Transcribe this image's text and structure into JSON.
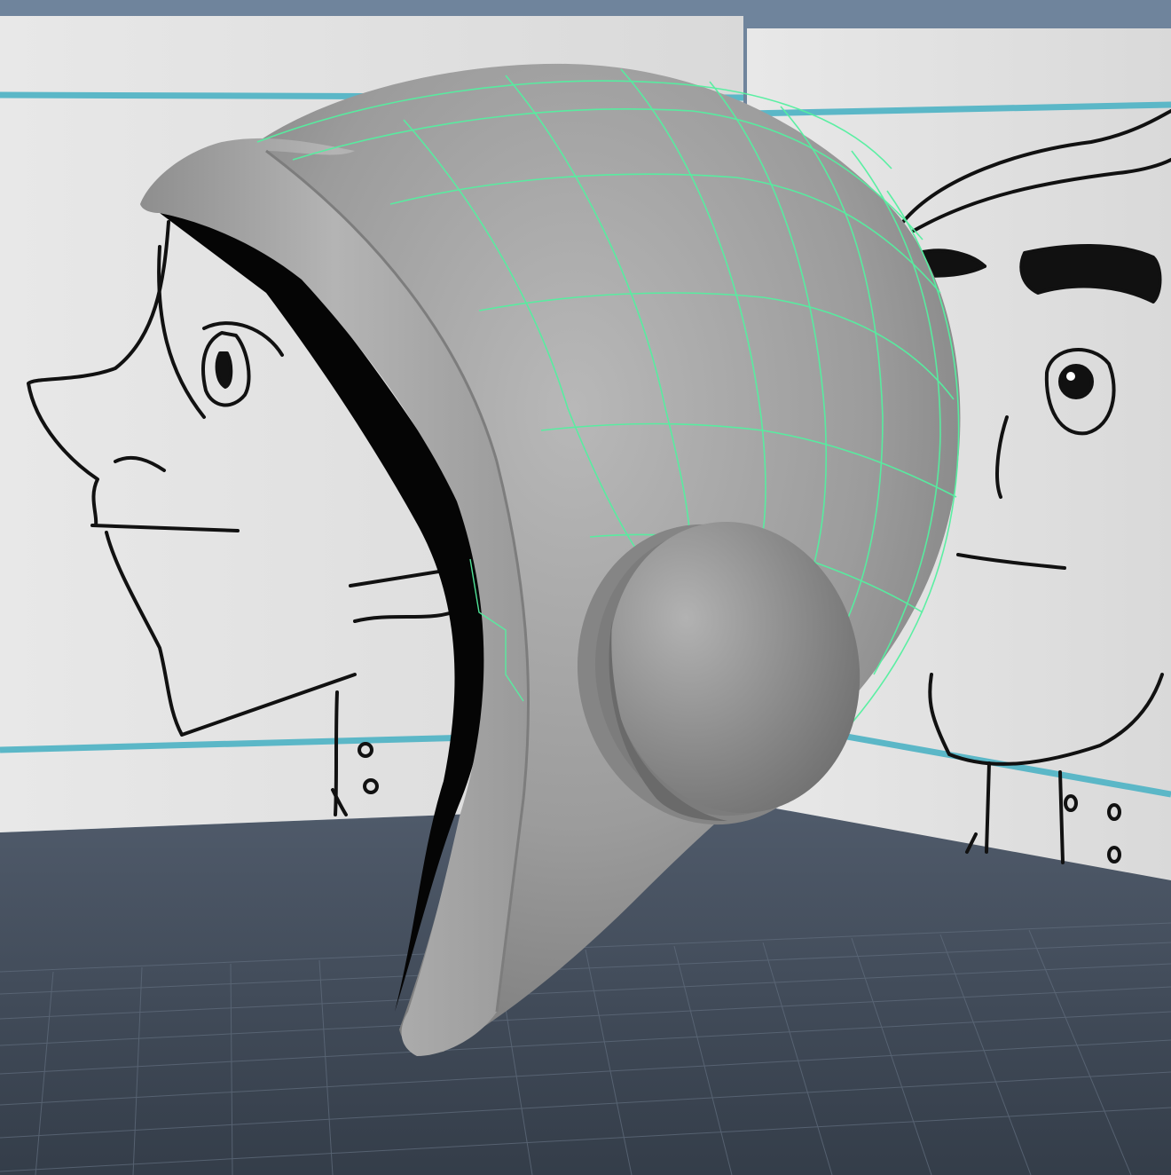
{
  "viewport": {
    "kind": "3d-perspective-viewport",
    "background_color": "#6f849c",
    "floor_color": "#4a5565",
    "grid_color": "#5a6676",
    "image_planes": [
      {
        "name": "side-view-reference",
        "content": "character-profile-sketch",
        "guide_line_color": "#5bb7c7"
      },
      {
        "name": "front-view-reference",
        "content": "character-front-sketch",
        "guide_line_color": "#5bb7c7"
      }
    ],
    "model": {
      "name": "helmet",
      "shading_color": "#9a9a9a",
      "selected_wireframe_color": "#54f0a0",
      "parts": [
        "helmet-shell",
        "helmet-rim",
        "ear-cup"
      ]
    }
  }
}
